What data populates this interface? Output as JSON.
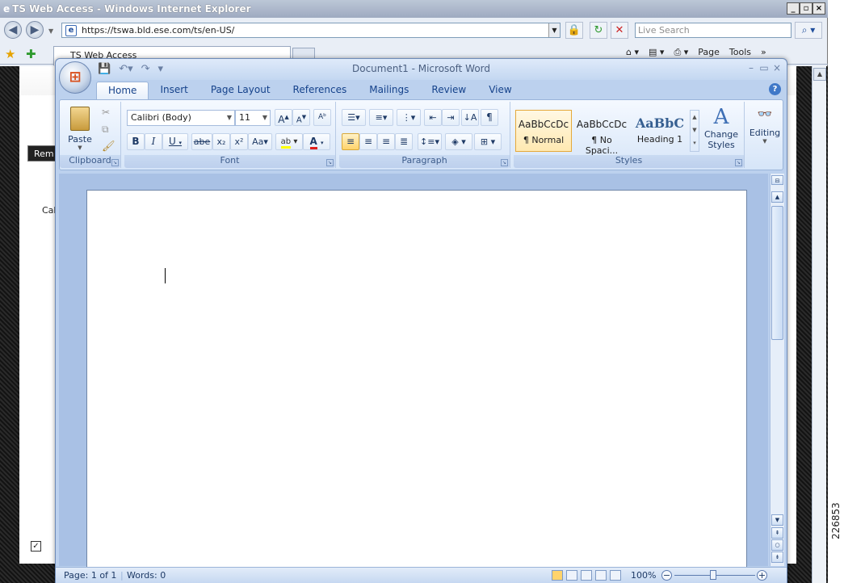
{
  "ie": {
    "title": "TS Web Access - Windows Internet Explorer",
    "url": "https://tswa.bld.ese.com/ts/en-US/",
    "search_placeholder": "Live Search",
    "tab_label": "TS Web Access",
    "tools": [
      "Page",
      "Tools"
    ]
  },
  "remote": {
    "toolbar_label": "Rem",
    "side_label": "Cal"
  },
  "word": {
    "title": "Document1 - Microsoft Word",
    "tabs": [
      "Home",
      "Insert",
      "Page Layout",
      "References",
      "Mailings",
      "Review",
      "View"
    ],
    "clipboard": {
      "paste": "Paste",
      "label": "Clipboard"
    },
    "font": {
      "name": "Calibri (Body)",
      "size": "11",
      "label": "Font"
    },
    "paragraph": {
      "label": "Paragraph"
    },
    "styles": {
      "label": "Styles",
      "items": [
        {
          "sample": "AaBbCcDc",
          "name": "¶ Normal"
        },
        {
          "sample": "AaBbCcDc",
          "name": "¶ No Spaci..."
        },
        {
          "sample": "AaBbC",
          "name": "Heading 1"
        }
      ],
      "change_styles": "Change Styles"
    },
    "editing": {
      "label": "Editing"
    },
    "status": {
      "page": "Page: 1 of 1",
      "words": "Words: 0",
      "zoom": "100%"
    }
  },
  "figure_number": "226853"
}
